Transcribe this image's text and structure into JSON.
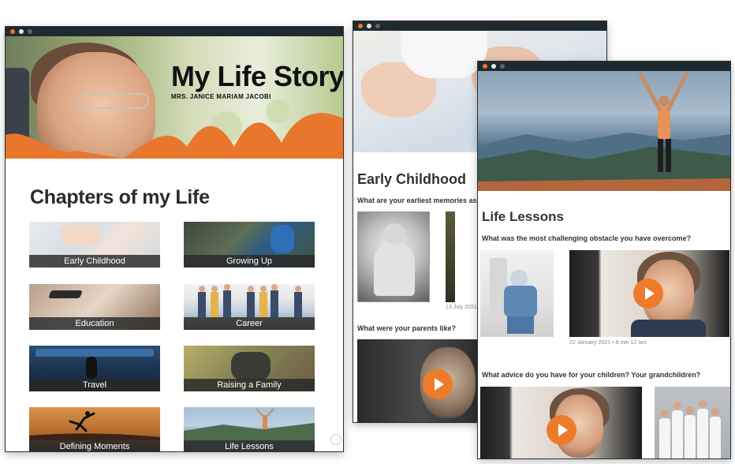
{
  "window1": {
    "hero_title": "My Life Story",
    "hero_subtitle": "MRS. JANICE MARIAM JACOBI",
    "section_heading": "Chapters of my Life",
    "chapters": [
      {
        "label": "Early Childhood"
      },
      {
        "label": "Growing Up"
      },
      {
        "label": "Education"
      },
      {
        "label": "Career"
      },
      {
        "label": "Travel"
      },
      {
        "label": "Raising a Family"
      },
      {
        "label": "Defining Moments"
      },
      {
        "label": "Life Lessons"
      }
    ]
  },
  "window2": {
    "title": "Early Childhood",
    "question1": "What are your earliest memories as a",
    "meta1": "13 July 2021 •",
    "question2": "What were your parents like?"
  },
  "window3": {
    "title": "Life Lessons",
    "question1": "What was the most challenging obstacle you have overcome?",
    "meta1": "22 January 2021 • 8 min 12 sec",
    "question2": "What advice do you have for your children?  Your grandchildren?"
  },
  "colors": {
    "accent": "#ee7a2b",
    "titlebar": "#1f2a30",
    "caption_bg": "#282828"
  }
}
